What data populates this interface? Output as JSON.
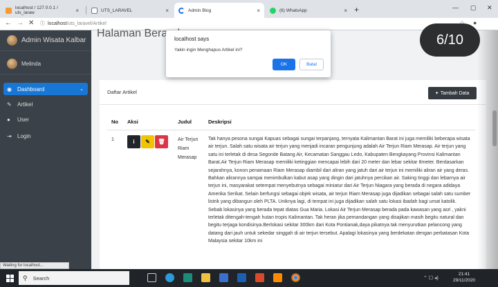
{
  "browser": {
    "tabs": [
      {
        "label": "localhost / 127.0.0.1 / uts_laraw",
        "active": false
      },
      {
        "label": "UTS_LARAVEL",
        "active": false
      },
      {
        "label": "Admin Blog",
        "active": true
      },
      {
        "label": "(6) WhatsApp",
        "active": false
      }
    ],
    "url_host": "localhost",
    "url_path": "/uts_laravel/Artikel"
  },
  "sidebar": {
    "brand": "Admin Wisata Kalbar",
    "user": "Melinda",
    "items": [
      {
        "label": "Dashboard",
        "icon": "palette-icon"
      },
      {
        "label": "Artikel",
        "icon": "edit-icon"
      },
      {
        "label": "User",
        "icon": "user-icon"
      },
      {
        "label": "Login",
        "icon": "sign-in-icon"
      }
    ]
  },
  "status_text": "Waiting for localhost...",
  "page": {
    "title": "Halaman Beranda"
  },
  "dialog": {
    "title": "localhost says",
    "message": "Yakin ingin Menghapus Artikel ini?",
    "ok": "OK",
    "cancel": "Batal"
  },
  "card": {
    "title": "Daftar Artikel",
    "add_button": "Tambah Data",
    "columns": [
      "No",
      "Aksi",
      "Judul",
      "Deskripsi"
    ],
    "rows": [
      {
        "no": "1",
        "judul": "Air Terjun Riam Merasap",
        "deskripsi": "Tak hanya pesona sungai Kapuas sebagai sungai terpanjang, ternyata Kalimantan Barat ini juga memiliki beberapa wisata air terjun. Salah satu wisata air terjun yang menjadi incaran pengunjung adalah Air Terjun Riam Merasap. Air terjun yang satu ini terletak di desa Segonde Batang Air, Kecamatan Sanggau Ledo, Kabupaten Bengkayang Provinsi Kalimantan Barat.Air Terjun Riam Merasap memiliki ketinggian mencapai lebih dari 20 meter dan lebar sekitar 8meter. Berdasarkan sejarahnya, konon penamaan Riam Merasap diambil dari aliran yang jatuh dari air terjun ini memiliki aliran air yang deras. Bahkan alirannya sampai menimbulkan kabut asap yang dingin dari jatuhnya percikan air. Saking tinggi dan lebarnya air terjun ini, masyarakat setempat menyebutnya sebagai miniatur dari Air Terjun Niagara yang berada di negara adidaya Amerika Serikat. Selain berfungsi sebagai objek wisata, air terjun Riam Merasap juga dijadikan sebagai salah satu sumber listrik yang dibangun oleh PLTA. Uniknya lagi, di tempat ini juga dijadikan salah satu lokasi ibadah bagi umat katolik. Sebab lokasinya yang berada tepat diatas Gua Maria. Lokasi Air Terjun Merasap berada pada kawasan yang asri , yakni terletak ditengah-tengah hutan tropis Kalimantan. Tak heran jika pemandangan yang disajikan masih begitu natural dan begitu terjaga kondisinya.Berlokasi sekitar 300km dari Kota Pontianak,daya pikatnya tak menyurutkan pelancong yang datang dari jauh untuk sekedar singgah di air terjun tersebut. Apalagi lokasinya yang berdekatan dengan perbatasan Kota Malaysia sekitar 10km ini"
      }
    ]
  },
  "overlay": {
    "counter": "6/10"
  },
  "taskbar": {
    "search": "Search",
    "time": "21:41",
    "date": "29/11/2020"
  }
}
